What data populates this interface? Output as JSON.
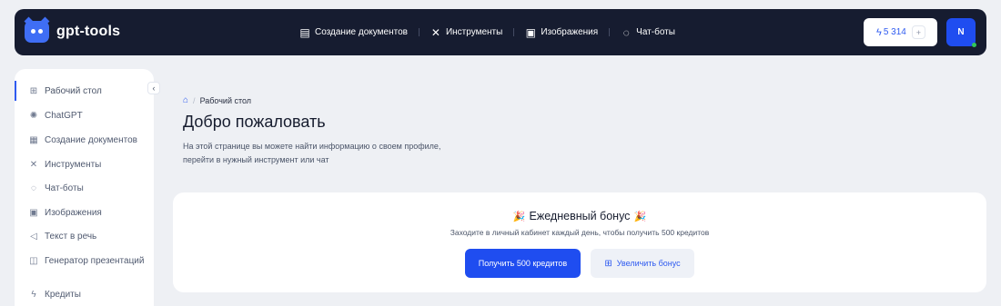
{
  "brand": {
    "name": "gpt-tools"
  },
  "topnav": [
    {
      "label": "Создание документов",
      "icon": "document-icon"
    },
    {
      "label": "Инструменты",
      "icon": "tools-icon"
    },
    {
      "label": "Изображения",
      "icon": "image-icon"
    },
    {
      "label": "Чат-боты",
      "icon": "chat-icon"
    }
  ],
  "credits": {
    "value": "5 314",
    "plus": "+"
  },
  "user": {
    "initial": "N"
  },
  "sidebar": {
    "items": [
      {
        "label": "Рабочий стол",
        "icon": "dashboard-icon",
        "active": true
      },
      {
        "label": "ChatGPT",
        "icon": "chatgpt-icon"
      },
      {
        "label": "Создание документов",
        "icon": "document-icon"
      },
      {
        "label": "Инструменты",
        "icon": "tools-icon"
      },
      {
        "label": "Чат-боты",
        "icon": "chat-icon"
      },
      {
        "label": "Изображения",
        "icon": "image-icon"
      },
      {
        "label": "Текст в речь",
        "icon": "speaker-icon"
      },
      {
        "label": "Генератор презентаций",
        "icon": "presentation-icon"
      },
      {
        "label": "Кредиты",
        "icon": "lightning-icon"
      }
    ]
  },
  "breadcrumb": {
    "current": "Рабочий стол"
  },
  "main": {
    "title": "Добро пожаловать",
    "description": "На этой странице вы можете найти информацию о своем профиле, перейти в нужный инструмент или чат"
  },
  "bonus": {
    "title": "Ежедневный бонус",
    "subtitle": "Заходите в личный кабинет каждый день, чтобы получить 500 кредитов",
    "primary_button": "Получить 500 кредитов",
    "secondary_button": "Увеличить бонус"
  },
  "colors": {
    "accent": "#1f4df0",
    "topbar": "#161c30",
    "background": "#eef0f4"
  }
}
